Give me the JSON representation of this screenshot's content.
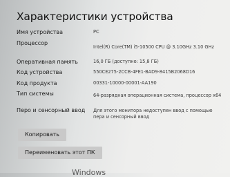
{
  "header": {
    "title": "Характеристики устройства"
  },
  "specs": [
    {
      "label": "Имя устройства",
      "value": "PC"
    },
    {
      "label": "Процессор",
      "value": "Intel(R) Core(TM) i5-10500 CPU @ 3.10GHz   3.10 GHz"
    },
    {
      "label": "Оперативная память",
      "value": "16,0 ГБ (доступно: 15,8 ГБ)"
    },
    {
      "label": "Код устройства",
      "value": "550CE275-2CCB-4FE1-BAD9-8415B2068D16"
    },
    {
      "label": "Код продукта",
      "value": "00331-10000-00001-AA190"
    },
    {
      "label": "Тип системы",
      "value": "64-разрядная операционная система, процессор x64"
    },
    {
      "label": "Перо и сенсорный ввод",
      "value": "Для этого монитора недоступен ввод с помощью пера и сенсорный ввод"
    }
  ],
  "buttons": {
    "copy": "Копировать",
    "rename": "Переименовать этот ПК"
  },
  "footer": {
    "partial_text": "Windows"
  }
}
